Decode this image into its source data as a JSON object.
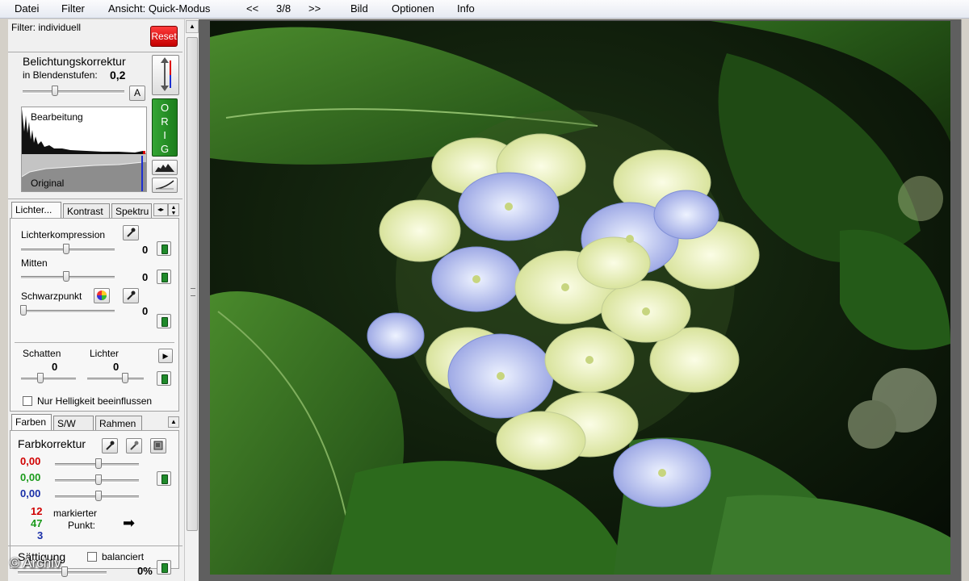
{
  "menu": {
    "datei": "Datei",
    "filter": "Filter",
    "ansicht": "Ansicht: Quick-Modus",
    "prev": "<<",
    "page_counter": "3/8",
    "next": ">>",
    "bild": "Bild",
    "optionen": "Optionen",
    "info": "Info"
  },
  "filter": {
    "label": "Filter: individuell",
    "reset": "Reset"
  },
  "exposure": {
    "title": "Belichtungskorrektur",
    "unit_label": "in Blendenstufen:",
    "value": "0,2",
    "auto_button": "A",
    "orig_letters": [
      "O",
      "R",
      "I",
      "G"
    ],
    "hist_top_label": "Bearbeitung",
    "hist_bottom_label": "Original"
  },
  "tabs_top": [
    "Lichter...",
    "Kontrast",
    "Spektru"
  ],
  "lichter": {
    "kompression_label": "Lichterkompression",
    "kompression_value": "0",
    "mitten_label": "Mitten",
    "mitten_value": "0",
    "schwarz_label": "Schwarzpunkt",
    "schwarz_value": "0",
    "schatten_label": "Schatten",
    "schatten_value": "0",
    "lichter2_label": "Lichter",
    "lichter2_value": "0",
    "nur_hell_label": "Nur Helligkeit beeinflussen"
  },
  "tabs_bottom": [
    "Farben",
    "S/W",
    "Rahmen"
  ],
  "farb": {
    "title": "Farbkorrektur",
    "red_value": "0,00",
    "green_value": "0,00",
    "blue_value": "0,00",
    "pixel_r": "12",
    "pixel_g": "47",
    "pixel_b": "3",
    "markierter": "markierter",
    "punkt": "Punkt:",
    "arrow": "➡",
    "colors": {
      "red": "#d00000",
      "green": "#1a9a1a",
      "blue": "#1a2fa8"
    }
  },
  "saettigung": {
    "label": "Sättigung",
    "balanced_label": "balanciert",
    "value": "0%"
  },
  "watermark": "© Archiv"
}
